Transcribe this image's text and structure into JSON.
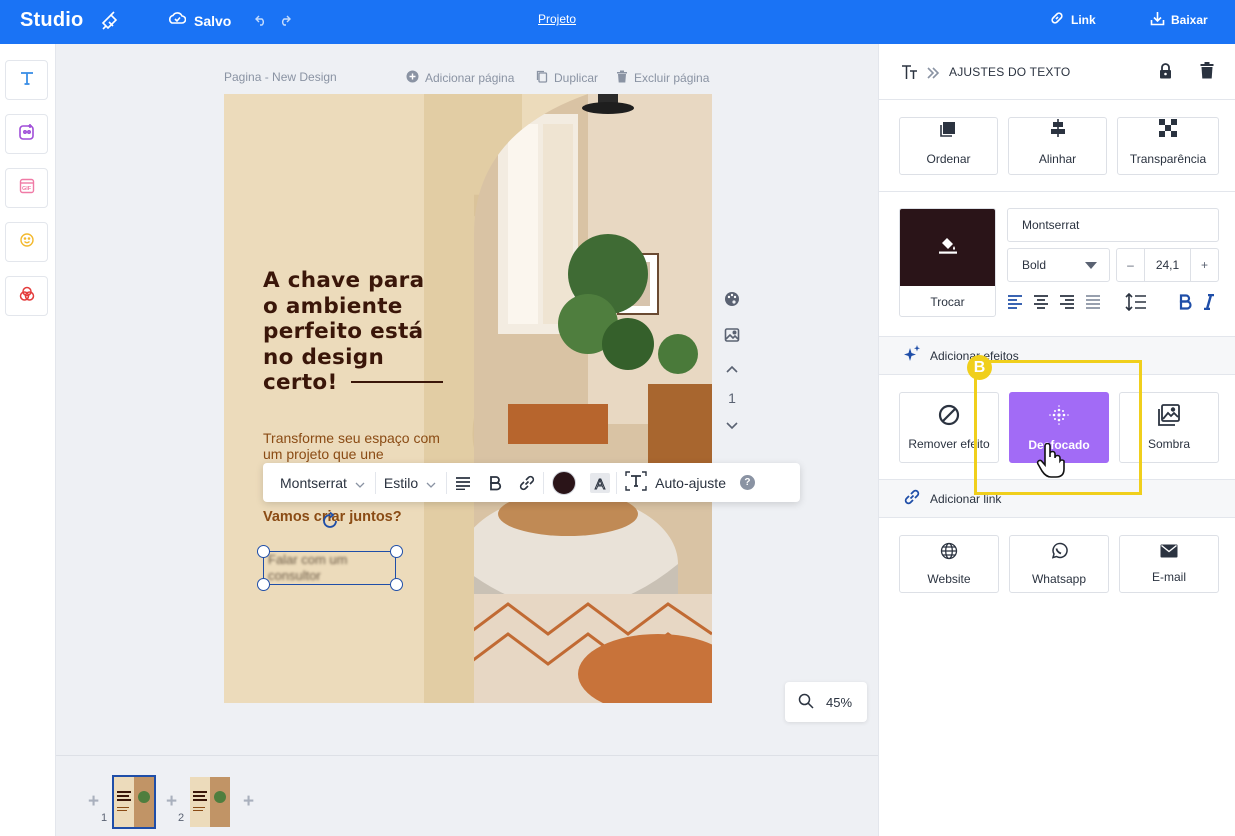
{
  "topbar": {
    "logo": "Studio",
    "save_status": "Salvo",
    "project": "Projeto",
    "link": "Link",
    "download": "Baixar"
  },
  "canvas": {
    "page_label": "Pagina - New Design",
    "add_page": "Adicionar página",
    "duplicate": "Duplicar",
    "delete_page": "Excluir página",
    "headline": [
      "A chave para",
      "o ambiente",
      "perfeito está",
      "no design",
      "certo!"
    ],
    "subtitle": "Transforme seu espaço com um projeto que une",
    "cta": "Vamos criar juntos?",
    "selected_text": "Falar com um consultor",
    "page_number": "1",
    "zoom": "45%"
  },
  "text_toolbar": {
    "font": "Montserrat",
    "style": "Estilo",
    "auto_fit": "Auto-ajuste",
    "text_color": "#2a1418"
  },
  "filmstrip": {
    "pages": [
      "1",
      "2"
    ],
    "active_page": "1"
  },
  "panel": {
    "title": "AJUSTES DO TEXTO",
    "actions": [
      "Ordenar",
      "Alinhar",
      "Transparência"
    ],
    "swap_label": "Trocar",
    "font_family": "Montserrat",
    "font_weight": "Bold",
    "font_size": "24,1",
    "effects_title": "Adicionar efeitos",
    "effects": [
      "Remover efeito",
      "Desfocado",
      "Sombra"
    ],
    "active_effect": "Desfocado",
    "link_title": "Adicionar link",
    "link_types": [
      "Website",
      "Whatsapp",
      "E-mail"
    ],
    "callout_badge": "B"
  },
  "colors": {
    "brand_blue": "#1a73f5",
    "selection_blue": "#1f4ea8",
    "effect_purple": "#a26bf6",
    "callout_yellow": "#f0cf1c",
    "headline_brown": "#3a1609",
    "text_brown": "#8a4b14",
    "page_beige": "#ecdbbb"
  }
}
